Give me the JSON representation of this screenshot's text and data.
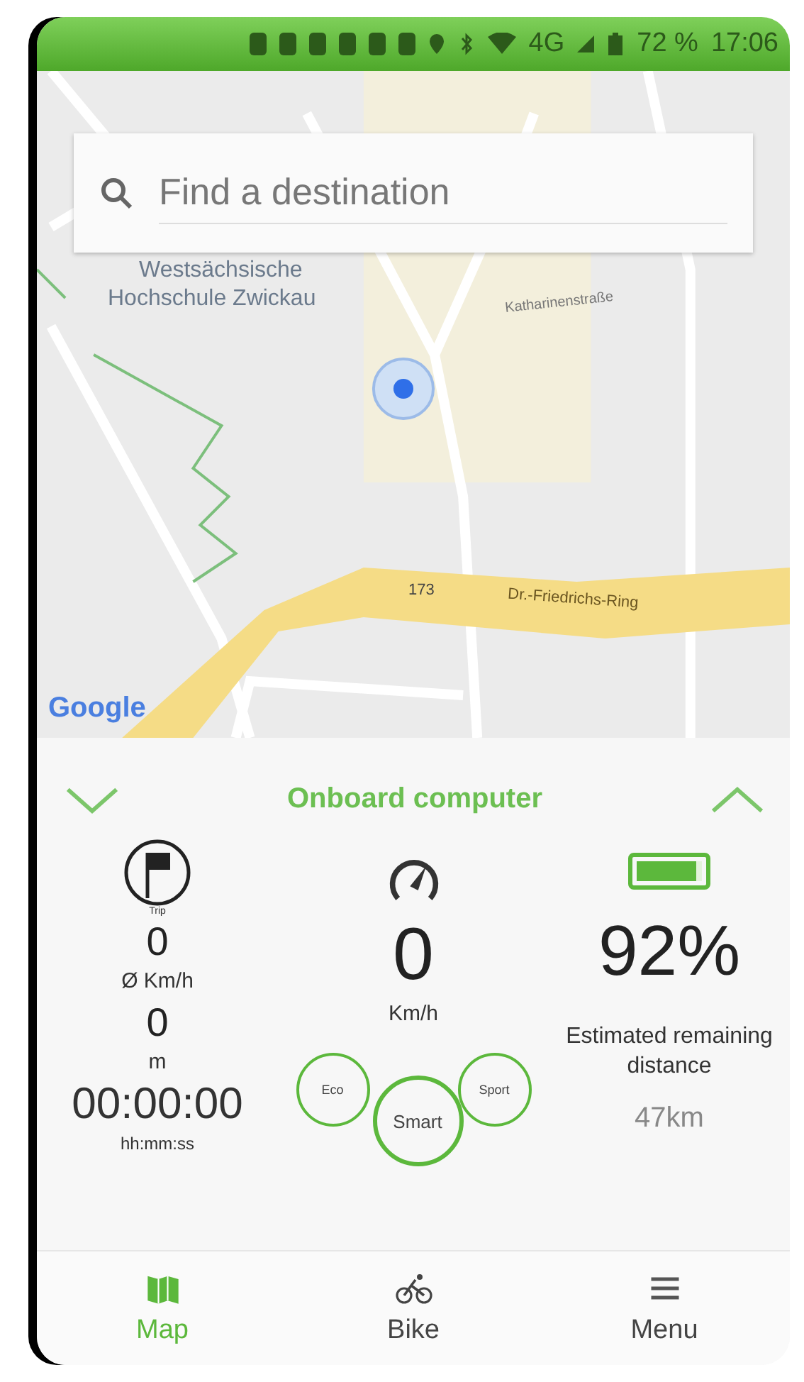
{
  "status_bar": {
    "network": "4G",
    "battery": "72 %",
    "time": "17:06"
  },
  "search": {
    "placeholder": "Find a destination"
  },
  "map": {
    "labels": [
      {
        "kind": "place",
        "text": "Westsächsische"
      },
      {
        "kind": "place",
        "text": "Hochschule Zwickau"
      },
      {
        "kind": "street",
        "text": "Katharinenstraße"
      },
      {
        "kind": "route",
        "text": "173"
      },
      {
        "kind": "road",
        "text": "Dr.-Friedrichs-Ring"
      }
    ],
    "attribution": "Google"
  },
  "onboard": {
    "title": "Onboard computer",
    "trip": {
      "icon_label": "Trip",
      "avg_speed": "0",
      "avg_speed_unit": "Ø Km/h",
      "distance": "0",
      "distance_unit": "m",
      "time": "00:00:00",
      "time_unit": "hh:mm:ss"
    },
    "speed": {
      "value": "0",
      "unit": "Km/h"
    },
    "battery": {
      "value": "92%",
      "level": 0.92,
      "range_label": "Estimated remaining distance",
      "range": "47km"
    },
    "modes": [
      {
        "label": "Eco",
        "selected": false
      },
      {
        "label": "Smart",
        "selected": true
      },
      {
        "label": "Sport",
        "selected": false
      }
    ]
  },
  "nav": [
    {
      "label": "Map",
      "kind": "map",
      "selected": true
    },
    {
      "label": "Bike",
      "kind": "bike",
      "selected": false
    },
    {
      "label": "Menu",
      "kind": "menu",
      "selected": false
    }
  ]
}
